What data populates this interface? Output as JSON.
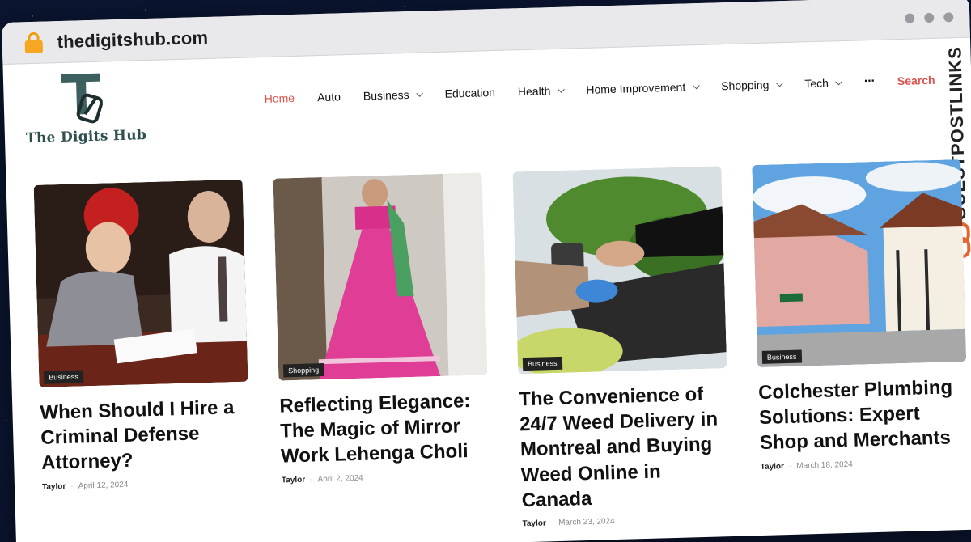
{
  "browser": {
    "url": "thedigitshub.com",
    "lock_icon": "lock-icon"
  },
  "site": {
    "logo_text": "The Digits Hub",
    "logo_letter": "T"
  },
  "nav": {
    "items": [
      {
        "label": "Home",
        "active": true,
        "dropdown": false
      },
      {
        "label": "Auto",
        "active": false,
        "dropdown": false
      },
      {
        "label": "Business",
        "active": false,
        "dropdown": true
      },
      {
        "label": "Education",
        "active": false,
        "dropdown": false
      },
      {
        "label": "Health",
        "active": false,
        "dropdown": true
      },
      {
        "label": "Home Improvement",
        "active": false,
        "dropdown": true
      },
      {
        "label": "Shopping",
        "active": false,
        "dropdown": true
      },
      {
        "label": "Tech",
        "active": false,
        "dropdown": true
      }
    ],
    "more_label": "···",
    "search_label": "Search"
  },
  "side_banner": {
    "text": "GUESTPOSTLINKS"
  },
  "articles": [
    {
      "category": "Business",
      "title": "When Should I Hire a Criminal Defense Attorney?",
      "author": "Taylor",
      "separator": "-",
      "date": "April 12, 2024"
    },
    {
      "category": "Shopping",
      "title": "Reflecting Elegance: The Magic of Mirror Work Lehenga Choli",
      "author": "Taylor",
      "separator": "-",
      "date": "April 2, 2024"
    },
    {
      "category": "Business",
      "title": "The Convenience of 24/7 Weed Delivery in Montreal and Buying Weed Online in Canada",
      "author": "Taylor",
      "separator": "-",
      "date": "March 23, 2024"
    },
    {
      "category": "Business",
      "title": "Colchester Plumbing Solutions: Expert Shop and Merchants",
      "author": "Taylor",
      "separator": "-",
      "date": "March 18, 2024"
    }
  ],
  "colors": {
    "accent": "#d9534f",
    "lock": "#f5a623",
    "logo": "#2f4f4f"
  }
}
